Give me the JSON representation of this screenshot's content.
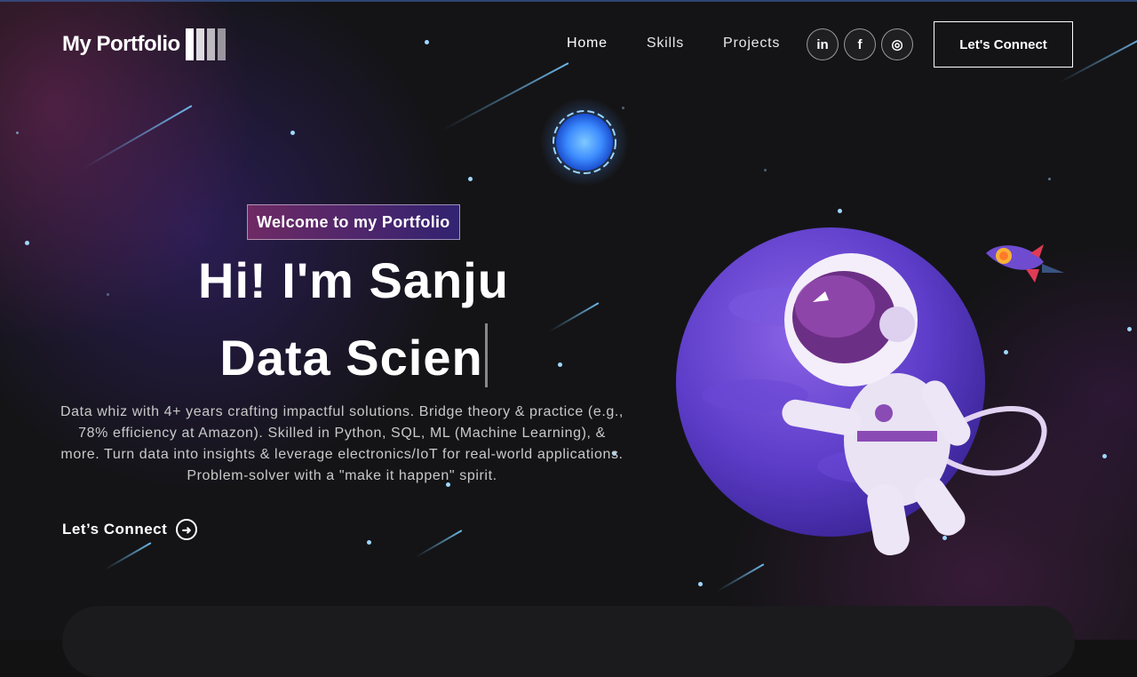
{
  "brand": {
    "name": "My Portfolio"
  },
  "nav": {
    "items": [
      "Home",
      "Skills",
      "Projects"
    ]
  },
  "social": [
    {
      "label": "in",
      "icon": "linkedin-icon"
    },
    {
      "label": "f",
      "icon": "facebook-icon"
    },
    {
      "label": "◎",
      "icon": "instagram-icon"
    }
  ],
  "header": {
    "connect_label": "Let's Connect"
  },
  "hero": {
    "badge": "Welcome to my Portfolio",
    "headline_line1": "Hi! I'm Sanju",
    "headline_line2": "Data Scien",
    "description": "Data whiz with 4+ years crafting impactful solutions. Bridge theory & practice (e.g., 78% efficiency at Amazon). Skilled in Python, SQL, ML (Machine Learning), & more. Turn data into insights & leverage electronics/IoT for real-world applications. Problem-solver with a \"make it happen\" spirit.",
    "cta_label": "Let’s Connect"
  },
  "colors": {
    "accent_pink": "#AA367C",
    "accent_purple": "#4A2FBD",
    "background": "#121212"
  }
}
